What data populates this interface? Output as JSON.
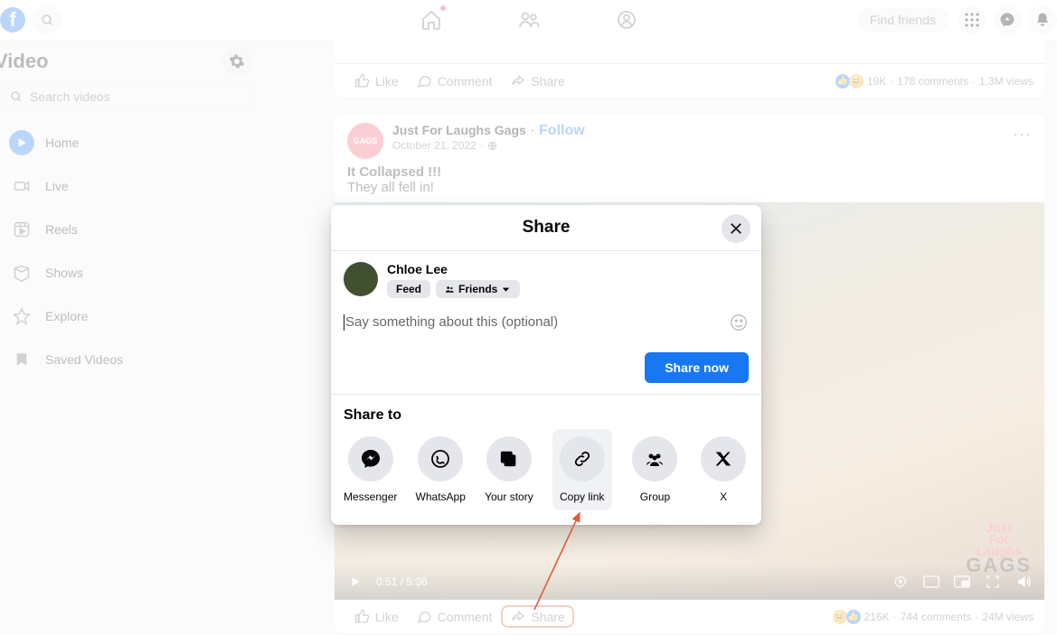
{
  "header": {
    "find_friends": "Find friends"
  },
  "sidebar": {
    "title": "Video",
    "search_placeholder": "Search videos",
    "items": [
      {
        "label": "Home"
      },
      {
        "label": "Live"
      },
      {
        "label": "Reels"
      },
      {
        "label": "Shows"
      },
      {
        "label": "Explore"
      },
      {
        "label": "Saved Videos"
      }
    ]
  },
  "prev_post": {
    "like": "Like",
    "comment": "Comment",
    "share": "Share",
    "reactions": "19K",
    "comments": "178 comments",
    "views": "1.3M views"
  },
  "post": {
    "avatar_text": "GAGS",
    "page_name": "Just For Laughs Gags",
    "follow": "Follow",
    "date": "October 21, 2022",
    "title": "It Collapsed !!!",
    "body": "They all fell in!",
    "time": "0:51 / 5:36",
    "like": "Like",
    "comment": "Comment",
    "share": "Share",
    "reactions": "216K",
    "comments": "744 comments",
    "views": "24M views",
    "watermark_top": "Just\nFor\nLaughs",
    "watermark_big": "GAGS"
  },
  "modal": {
    "title": "Share",
    "user": "Chloe Lee",
    "chip_feed": "Feed",
    "chip_audience": "Friends",
    "placeholder": "Say something about this (optional)",
    "share_now": "Share now",
    "share_to_title": "Share to",
    "targets": [
      {
        "label": "Messenger"
      },
      {
        "label": "WhatsApp"
      },
      {
        "label": "Your story"
      },
      {
        "label": "Copy link"
      },
      {
        "label": "Group"
      },
      {
        "label": "X"
      }
    ]
  }
}
